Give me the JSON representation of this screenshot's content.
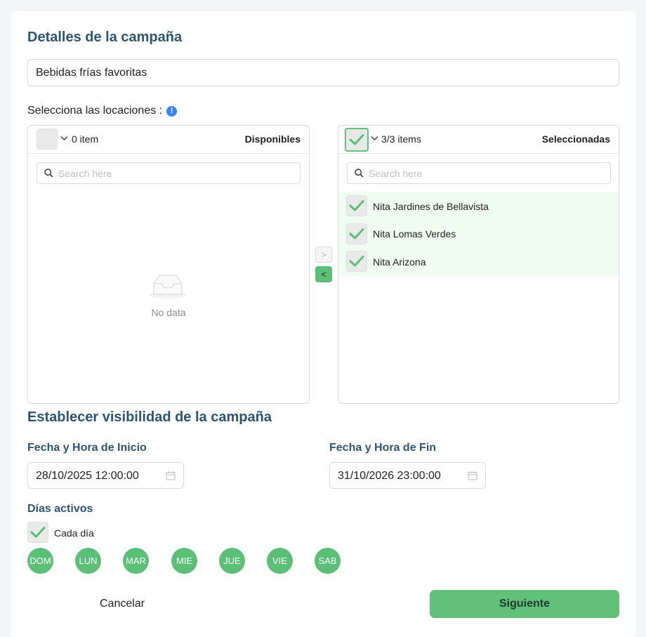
{
  "campaign": {
    "title": "Detalles de la campaña",
    "name_value": "Bebidas frías favoritas"
  },
  "locations": {
    "label": "Selecciona las locaciones :",
    "info_glyph": "!",
    "available": {
      "count": "0 item",
      "title": "Disponibles",
      "search_placeholder": "Search here",
      "empty_text": "No data"
    },
    "selected": {
      "count": "3/3 items",
      "title": "Seleccionadas",
      "search_placeholder": "Search here",
      "items": [
        {
          "label": "Nita Jardines de Bellavista",
          "checked": true
        },
        {
          "label": "Nita Lomas Verdes",
          "checked": true
        },
        {
          "label": "Nita Arizona",
          "checked": true
        }
      ]
    },
    "move_right_glyph": ">",
    "move_left_glyph": "<"
  },
  "visibility": {
    "title": "Establecer visibilidad de la campaña",
    "start_label": "Fecha y Hora de Inicio",
    "start_value": "28/10/2025 12:00:00",
    "end_label": "Fecha y Hora de Fin",
    "end_value": "31/10/2026 23:00:00",
    "active_days_label": "Días activos",
    "every_day_label": "Cada día",
    "every_day_checked": true,
    "days": [
      "DOM",
      "LUN",
      "MAR",
      "MIE",
      "JUE",
      "VIE",
      "SAB"
    ]
  },
  "actions": {
    "cancel_label": "Cancelar",
    "next_label": "Siguiente"
  },
  "colors": {
    "accent_green": "#5bbf77",
    "heading_blue": "#2e5470",
    "info_blue": "#3b82f6",
    "selected_row_bg": "#f0fbf2"
  }
}
